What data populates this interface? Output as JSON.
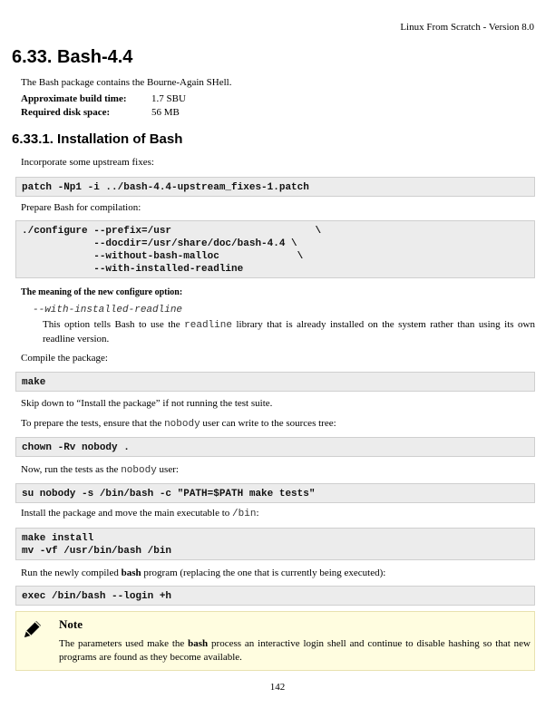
{
  "header": {
    "text": "Linux From Scratch - Version 8.0"
  },
  "section": {
    "title": "6.33. Bash-4.4",
    "intro": "The Bash package contains the Bourne-Again SHell.",
    "build_time_label": "Approximate build time:",
    "build_time_value": "1.7 SBU",
    "disk_label": "Required disk space:",
    "disk_value": "56 MB"
  },
  "subsection": {
    "title": "6.33.1. Installation of Bash"
  },
  "p_fixes": "Incorporate some upstream fixes:",
  "code_patch": "patch -Np1 -i ../bash-4.4-upstream_fixes-1.patch",
  "p_prepare": "Prepare Bash for compilation:",
  "code_configure": "./configure --prefix=/usr                        \\\n            --docdir=/usr/share/doc/bash-4.4 \\\n            --without-bash-malloc             \\\n            --with-installed-readline",
  "meaning_title": "The meaning of the new configure option:",
  "option_term": "--with-installed-readline",
  "option_def_1": "This option tells Bash to use the ",
  "option_def_code": "readline",
  "option_def_2": " library that is already installed on the system rather than using its own readline version.",
  "p_compile": "Compile the package:",
  "code_make": "make",
  "p_skip": "Skip down to “Install the package” if not running the test suite.",
  "p_tests_1": "To prepare the tests, ensure that the ",
  "p_tests_code": "nobody",
  "p_tests_2": " user can write to the sources tree:",
  "code_chown": "chown -Rv nobody .",
  "p_run_1": "Now, run the tests as the ",
  "p_run_code": "nobody",
  "p_run_2": " user:",
  "code_su": "su nobody -s /bin/bash -c \"PATH=$PATH make tests\"",
  "p_install_1": "Install the package and move the main executable to ",
  "p_install_code": "/bin",
  "p_install_2": ":",
  "code_install": "make install\nmv -vf /usr/bin/bash /bin",
  "p_exec_1": "Run the newly compiled ",
  "p_exec_bold": "bash",
  "p_exec_2": " program (replacing the one that is currently being executed):",
  "code_exec": "exec /bin/bash --login +h",
  "note": {
    "icon": "pencil-icon",
    "title": "Note",
    "text_1": "The parameters used make the ",
    "text_bold": "bash",
    "text_2": " process an interactive login shell and continue to disable hashing so that new programs are found as they become available."
  },
  "page_number": "142"
}
